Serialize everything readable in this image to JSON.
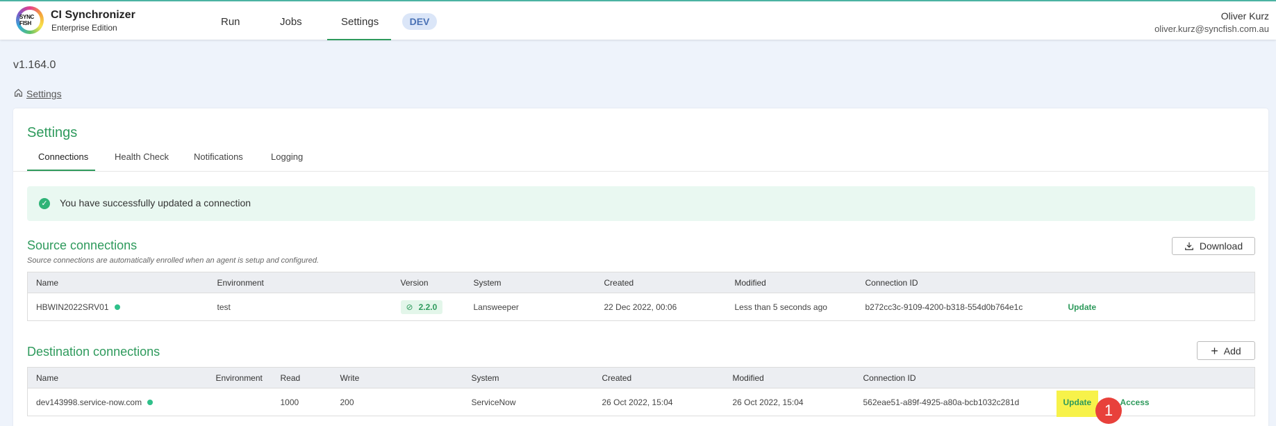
{
  "app": {
    "logo_text": "SYNC FISH",
    "title": "CI Synchronizer",
    "subtitle": "Enterprise Edition",
    "nav": [
      "Run",
      "Jobs",
      "Settings"
    ],
    "env_badge": "DEV"
  },
  "user": {
    "name": "Oliver Kurz",
    "email": "oliver.kurz@syncfish.com.au"
  },
  "version": "v1.164.0",
  "breadcrumb": {
    "label": "Settings"
  },
  "settings": {
    "title": "Settings",
    "tabs": [
      "Connections",
      "Health Check",
      "Notifications",
      "Logging"
    ],
    "active_tab": "Connections"
  },
  "alert": {
    "text": "You have successfully updated a connection"
  },
  "source": {
    "title": "Source connections",
    "subtitle": "Source connections are automatically enrolled when an agent is setup and configured.",
    "download_label": "Download",
    "columns": [
      "Name",
      "Environment",
      "Version",
      "System",
      "Created",
      "Modified",
      "Connection ID"
    ],
    "rows": [
      {
        "name": "HBWIN2022SRV01",
        "environment": "test",
        "version": "2.2.0",
        "system": "Lansweeper",
        "created": "22 Dec 2022, 00:06",
        "modified": "Less than 5 seconds ago",
        "connection_id": "b272cc3c-9109-4200-b318-554d0b764e1c",
        "action": "Update"
      }
    ]
  },
  "destination": {
    "title": "Destination connections",
    "add_label": "Add",
    "columns": [
      "Name",
      "Environment",
      "Read",
      "Write",
      "System",
      "Created",
      "Modified",
      "Connection ID"
    ],
    "rows": [
      {
        "name": "dev143998.service-now.com",
        "environment": "",
        "read": "1000",
        "write": "200",
        "system": "ServiceNow",
        "created": "26 Oct 2022, 15:04",
        "modified": "26 Oct 2022, 15:04",
        "connection_id": "562eae51-a89f-4925-a80a-bcb1032c281d",
        "action_update": "Update",
        "action_access": "Access"
      }
    ]
  },
  "step_marker": "1",
  "colors": {
    "accent": "#2e9a5c",
    "status_online": "#2fc08a",
    "highlight": "#f7f24a",
    "marker": "#e8413b"
  }
}
